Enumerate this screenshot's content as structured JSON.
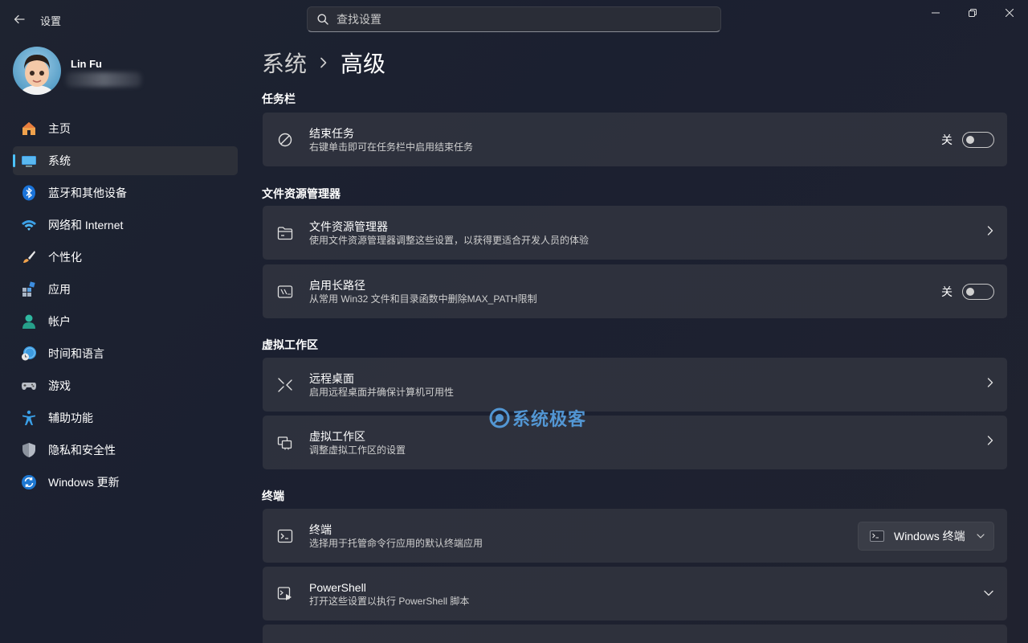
{
  "window": {
    "app_title": "设置"
  },
  "search": {
    "placeholder": "查找设置"
  },
  "profile": {
    "name": "Lin Fu"
  },
  "sidebar": {
    "items": [
      {
        "label": "主页",
        "icon": "home-icon"
      },
      {
        "label": "系统",
        "icon": "system-icon",
        "active": true
      },
      {
        "label": "蓝牙和其他设备",
        "icon": "bluetooth-icon"
      },
      {
        "label": "网络和 Internet",
        "icon": "wifi-icon"
      },
      {
        "label": "个性化",
        "icon": "brush-icon"
      },
      {
        "label": "应用",
        "icon": "apps-icon"
      },
      {
        "label": "帐户",
        "icon": "account-icon"
      },
      {
        "label": "时间和语言",
        "icon": "globe-clock-icon"
      },
      {
        "label": "游戏",
        "icon": "gamepad-icon"
      },
      {
        "label": "辅助功能",
        "icon": "accessibility-icon"
      },
      {
        "label": "隐私和安全性",
        "icon": "shield-icon"
      },
      {
        "label": "Windows 更新",
        "icon": "update-icon"
      }
    ]
  },
  "breadcrumb": {
    "parent": "系统",
    "current": "高级"
  },
  "sections": {
    "taskbar": "任务栏",
    "explorer": "文件资源管理器",
    "virtual": "虚拟工作区",
    "terminal": "终端"
  },
  "cards": {
    "end_task": {
      "title": "结束任务",
      "sub": "右键单击即可在任务栏中启用结束任务",
      "toggle_label": "关",
      "toggle_on": false
    },
    "file_explorer": {
      "title": "文件资源管理器",
      "sub": "使用文件资源管理器调整这些设置，以获得更适合开发人员的体验"
    },
    "long_path": {
      "title": "启用长路径",
      "sub": "从常用 Win32 文件和目录函数中删除MAX_PATH限制",
      "toggle_label": "关",
      "toggle_on": false
    },
    "remote_desktop": {
      "title": "远程桌面",
      "sub": "启用远程桌面并确保计算机可用性"
    },
    "virtual_workspace": {
      "title": "虚拟工作区",
      "sub": "调整虚拟工作区的设置"
    },
    "terminal": {
      "title": "终端",
      "sub": "选择用于托管命令行应用的默认终端应用",
      "dropdown_value": "Windows 终端"
    },
    "powershell": {
      "title": "PowerShell",
      "sub": "打开这些设置以执行 PowerShell 脚本"
    }
  },
  "watermark": "系统极客",
  "colors": {
    "accent": "#4cc2ff",
    "card_bg": "#343742"
  }
}
